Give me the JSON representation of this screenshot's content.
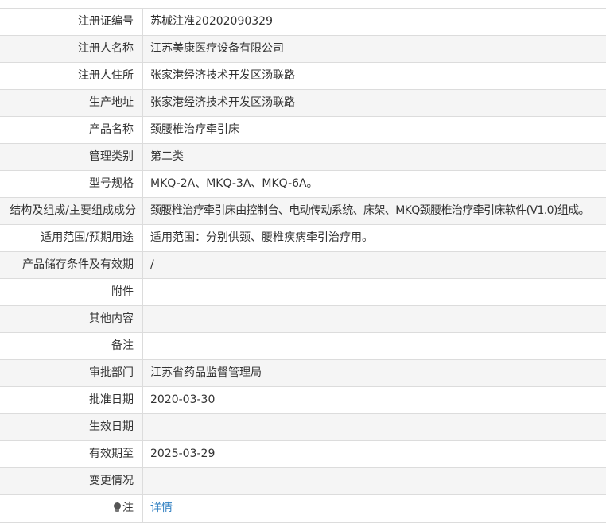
{
  "record": {
    "rows": [
      {
        "label": "注册证编号",
        "value": "苏械注准20202090329"
      },
      {
        "label": "注册人名称",
        "value": "江苏美康医疗设备有限公司"
      },
      {
        "label": "注册人住所",
        "value": "张家港经济技术开发区汤联路"
      },
      {
        "label": "生产地址",
        "value": "张家港经济技术开发区汤联路"
      },
      {
        "label": "产品名称",
        "value": "颈腰椎治疗牵引床"
      },
      {
        "label": "管理类别",
        "value": "第二类"
      },
      {
        "label": "型号规格",
        "value": "MKQ-2A、MKQ-3A、MKQ-6A。"
      },
      {
        "label": "结构及组成/主要组成成分",
        "value": "颈腰椎治疗牵引床由控制台、电动传动系统、床架、MKQ颈腰椎治疗牵引床软件(V1.0)组成。"
      },
      {
        "label": "适用范围/预期用途",
        "value": "适用范围：分别供颈、腰椎疾病牵引治疗用。"
      },
      {
        "label": "产品储存条件及有效期",
        "value": "/"
      },
      {
        "label": "附件",
        "value": ""
      },
      {
        "label": "其他内容",
        "value": ""
      },
      {
        "label": "备注",
        "value": ""
      },
      {
        "label": "审批部门",
        "value": "江苏省药品监督管理局"
      },
      {
        "label": "批准日期",
        "value": "2020-03-30"
      },
      {
        "label": "生效日期",
        "value": ""
      },
      {
        "label": "有效期至",
        "value": "2025-03-29"
      },
      {
        "label": "变更情况",
        "value": ""
      }
    ],
    "note": {
      "label": "注",
      "icon": "lightbulb-icon",
      "link_text": "详情"
    }
  },
  "colors": {
    "border": "#dcdcdc",
    "alt_row": "#f5f5f5",
    "text": "#333333",
    "link": "#2f7fc1"
  }
}
